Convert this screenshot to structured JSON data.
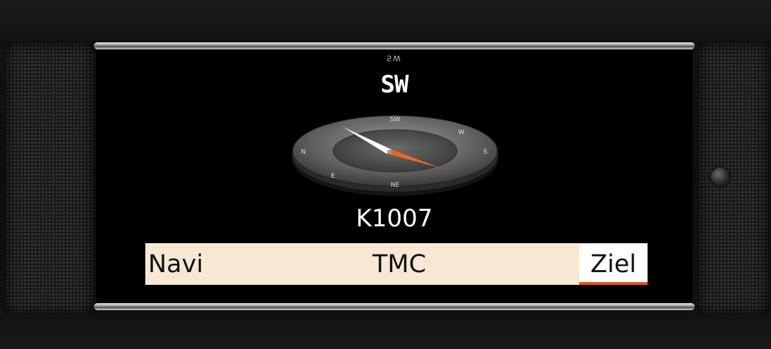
{
  "display": {
    "heading_mirrored": "SW",
    "heading": "SW",
    "road": "K1007"
  },
  "compass": {
    "dial_labels": [
      "SW",
      "W",
      "NE",
      "N",
      "S",
      "E"
    ],
    "needle_colors": {
      "north": "#e8682a",
      "south": "#ffffff"
    }
  },
  "softkeys": {
    "navi": "Navi",
    "tmc": "TMC",
    "ziel": "Ziel"
  },
  "colors": {
    "softkey_bar": "#f6e8d3",
    "accent": "#d85a22"
  }
}
